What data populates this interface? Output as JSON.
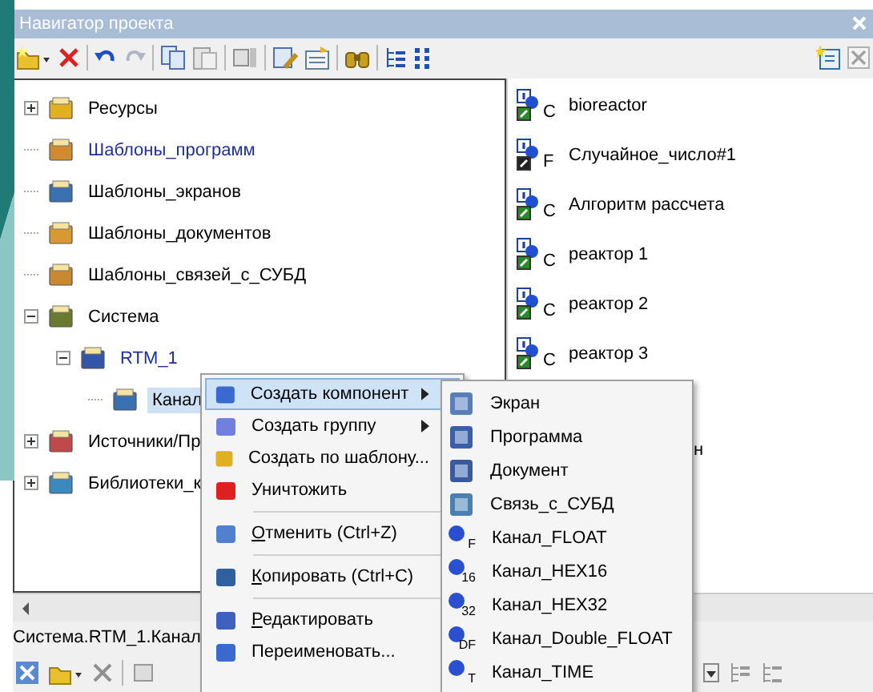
{
  "window": {
    "title": "Навигатор проекта"
  },
  "tree": [
    {
      "label": "Ресурсы",
      "expandable": true,
      "expanded": false,
      "color": "#000000",
      "selected": false
    },
    {
      "label": "Шаблоны_программ",
      "color": "#1f2f9a",
      "selected": false
    },
    {
      "label": "Шаблоны_экранов",
      "color": "#000000",
      "selected": false
    },
    {
      "label": "Шаблоны_документов",
      "color": "#000000",
      "selected": false
    },
    {
      "label": "Шаблоны_связей_с_СУБД",
      "color": "#000000",
      "selected": false
    },
    {
      "label": "Система",
      "expandable": true,
      "expanded": true,
      "color": "#000000",
      "selected": false,
      "children": [
        {
          "label": "RTM_1",
          "expandable": true,
          "expanded": true,
          "color": "#1f2f9a",
          "selected": false,
          "children": [
            {
              "label": "Канал",
              "color": "#000000",
              "selected": true
            }
          ]
        }
      ]
    },
    {
      "label": "Источники/Пр",
      "expandable": true,
      "expanded": false,
      "color": "#000000",
      "selected": false
    },
    {
      "label": "Библиотеки_к",
      "expandable": true,
      "expanded": false,
      "color": "#000000",
      "selected": false
    }
  ],
  "components": [
    {
      "name": "bioreactor",
      "type": "C"
    },
    {
      "name": "Случайное_число#1",
      "type": "F"
    },
    {
      "name": "Алгоритм рассчета",
      "type": "C"
    },
    {
      "name": "реактор 1",
      "type": "C"
    },
    {
      "name": "реактор 2",
      "type": "C"
    },
    {
      "name": "реактор 3",
      "type": "C"
    }
  ],
  "covered_component_tail": "н",
  "status_path": "Система.RTM_1.Канал",
  "context_menu": [
    {
      "kind": "item",
      "label": "Создать компонент",
      "submenu": true,
      "mnemonic": false,
      "selected": true
    },
    {
      "kind": "item",
      "label": "Создать группу",
      "submenu": true,
      "mnemonic": false,
      "selected": false
    },
    {
      "kind": "item",
      "label": "Создать по шаблону...",
      "submenu": false,
      "mnemonic": false,
      "selected": false
    },
    {
      "kind": "item",
      "label": "Уничтожить",
      "submenu": false,
      "mnemonic": false,
      "selected": false
    },
    {
      "kind": "separator"
    },
    {
      "kind": "item",
      "label": "Отменить (Ctrl+Z)",
      "submenu": false,
      "mnemonic": true,
      "selected": false
    },
    {
      "kind": "separator"
    },
    {
      "kind": "item",
      "label": "Копировать (Ctrl+C)",
      "submenu": false,
      "mnemonic": true,
      "selected": false
    },
    {
      "kind": "separator"
    },
    {
      "kind": "item",
      "label": "Редактировать",
      "submenu": false,
      "mnemonic": true,
      "selected": false
    },
    {
      "kind": "item",
      "label": "Переименовать...",
      "submenu": false,
      "mnemonic": false,
      "selected": false
    }
  ],
  "submenu": [
    {
      "label": "Экран"
    },
    {
      "label": "Программа"
    },
    {
      "label": "Документ"
    },
    {
      "label": "Связь_с_СУБД"
    },
    {
      "label": "Канал_FLOAT",
      "badge": "F"
    },
    {
      "label": "Канал_HEX16",
      "badge": "16"
    },
    {
      "label": "Канал_HEX32",
      "badge": "32"
    },
    {
      "label": "Канал_Double_FLOAT",
      "badge": "DF"
    },
    {
      "label": "Канал_TIME",
      "badge": "T"
    }
  ]
}
